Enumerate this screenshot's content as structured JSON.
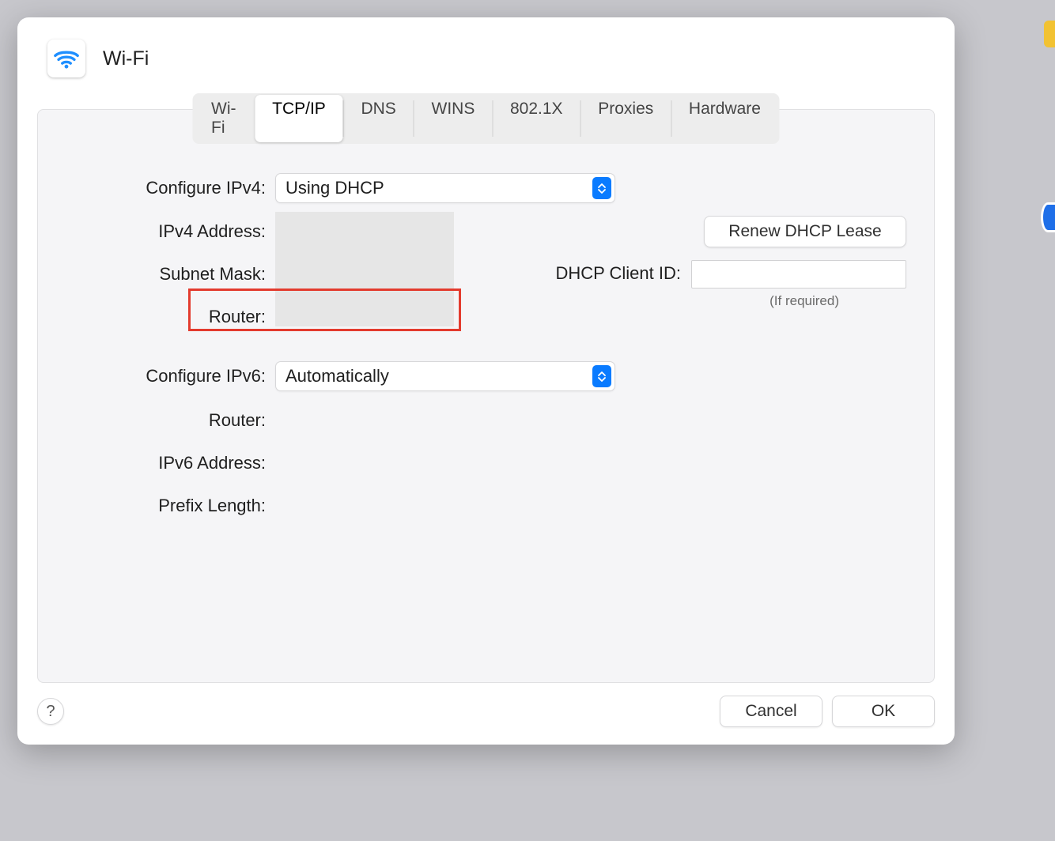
{
  "header": {
    "title": "Wi-Fi",
    "icon": "wifi-icon"
  },
  "tabs": [
    {
      "label": "Wi-Fi",
      "active": false
    },
    {
      "label": "TCP/IP",
      "active": true
    },
    {
      "label": "DNS",
      "active": false
    },
    {
      "label": "WINS",
      "active": false
    },
    {
      "label": "802.1X",
      "active": false
    },
    {
      "label": "Proxies",
      "active": false
    },
    {
      "label": "Hardware",
      "active": false
    }
  ],
  "ipv4": {
    "configure_label": "Configure IPv4:",
    "configure_value": "Using DHCP",
    "address_label": "IPv4 Address:",
    "subnet_label": "Subnet Mask:",
    "router_label": "Router:"
  },
  "dhcp": {
    "renew_button": "Renew DHCP Lease",
    "client_id_label": "DHCP Client ID:",
    "client_id_value": "",
    "if_required": "(If required)"
  },
  "ipv6": {
    "configure_label": "Configure IPv6:",
    "configure_value": "Automatically",
    "router_label": "Router:",
    "address_label": "IPv6 Address:",
    "prefix_label": "Prefix Length:"
  },
  "footer": {
    "help": "?",
    "cancel": "Cancel",
    "ok": "OK"
  },
  "highlight": {
    "target": "ipv4-router-row"
  }
}
